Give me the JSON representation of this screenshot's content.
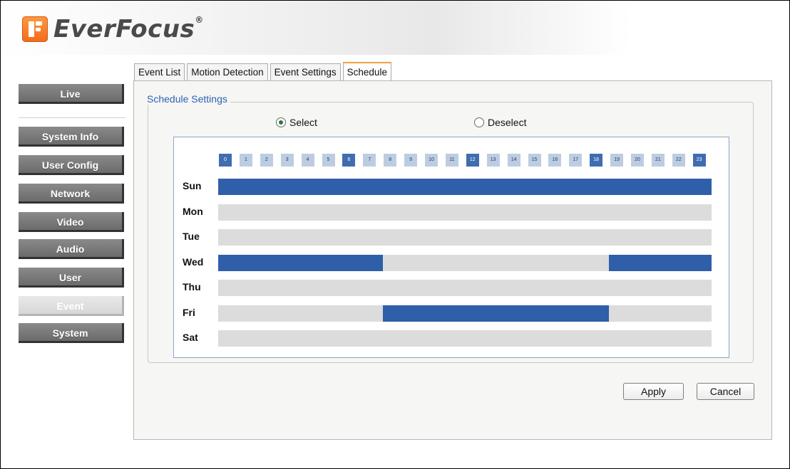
{
  "brand": {
    "name": "EverFocus",
    "reg": "®"
  },
  "sidebar": {
    "items": [
      {
        "label": "Live",
        "active": false
      },
      {
        "label": "System Info",
        "active": false
      },
      {
        "label": "User Config",
        "active": false
      },
      {
        "label": "Network",
        "active": false
      },
      {
        "label": "Video",
        "active": false
      },
      {
        "label": "Audio",
        "active": false
      },
      {
        "label": "User",
        "active": false
      },
      {
        "label": "Event",
        "active": true
      },
      {
        "label": "System",
        "active": false
      }
    ]
  },
  "tabs": [
    {
      "label": "Event List",
      "active": false
    },
    {
      "label": "Motion Detection",
      "active": false
    },
    {
      "label": "Event Settings",
      "active": false
    },
    {
      "label": "Schedule",
      "active": true
    }
  ],
  "schedule": {
    "legend": "Schedule Settings",
    "select_label": "Select",
    "deselect_label": "Deselect",
    "mode": "select",
    "hours": [
      "0",
      "1",
      "2",
      "3",
      "4",
      "5",
      "6",
      "7",
      "8",
      "9",
      "10",
      "11",
      "12",
      "13",
      "14",
      "15",
      "16",
      "17",
      "18",
      "19",
      "20",
      "21",
      "22",
      "23"
    ],
    "highlighted_hours": [
      0,
      6,
      12,
      18,
      23
    ],
    "days": [
      {
        "label": "Sun",
        "ranges": [
          [
            0,
            24
          ]
        ]
      },
      {
        "label": "Mon",
        "ranges": []
      },
      {
        "label": "Tue",
        "ranges": []
      },
      {
        "label": "Wed",
        "ranges": [
          [
            0,
            8
          ],
          [
            19,
            24
          ]
        ]
      },
      {
        "label": "Thu",
        "ranges": []
      },
      {
        "label": "Fri",
        "ranges": [
          [
            8,
            19
          ]
        ]
      },
      {
        "label": "Sat",
        "ranges": []
      }
    ]
  },
  "buttons": {
    "apply": "Apply",
    "cancel": "Cancel"
  },
  "colors": {
    "selected": "#2e5fa8",
    "unselected": "#dcdcdc",
    "accent_tab": "#f2a33a",
    "legend": "#2b63b0"
  }
}
